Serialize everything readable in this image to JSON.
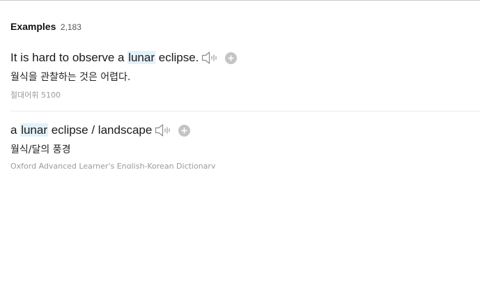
{
  "examples_section": {
    "title": "Examples",
    "count": "2,183"
  },
  "examples": [
    {
      "sentence_before": "It is hard to observe a ",
      "highlight": "lunar",
      "sentence_after": " eclipse.",
      "translation": "월식을 관찰하는 것은 어렵다.",
      "source": "절대어휘 5100",
      "icons": [
        "speaker-icon",
        "add-icon"
      ]
    },
    {
      "sentence_before": "a ",
      "highlight": "lunar",
      "sentence_after": " eclipse / landscape",
      "translation": "월식/달의 풍경",
      "source": "Oxford Advanced Learner's English-Korean Dictionary",
      "icons": [
        "speaker-icon",
        "add-icon"
      ]
    }
  ],
  "colors": {
    "highlight_bg": "#e3f1fb",
    "source_text": "#9a9a9a",
    "icon_gray": "#b5b5b5"
  }
}
